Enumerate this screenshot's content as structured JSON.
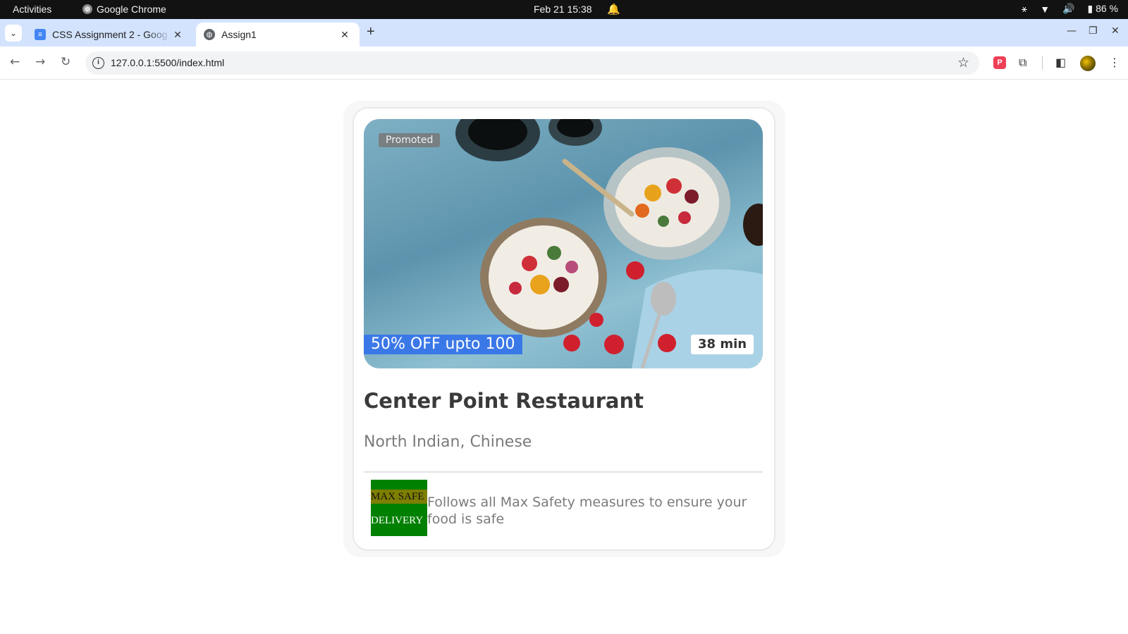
{
  "system_bar": {
    "activities": "Activities",
    "app_name": "Google Chrome",
    "datetime": "Feb 21  15:38",
    "battery": "86 %"
  },
  "browser": {
    "tabs": [
      {
        "title": "CSS Assignment 2 - Goog",
        "icon": "google-docs-icon",
        "active": false
      },
      {
        "title": "Assign1",
        "icon": "globe-icon",
        "active": true
      }
    ],
    "url": "127.0.0.1:5500/index.html"
  },
  "card": {
    "promoted_label": "Promoted",
    "offer": "50% OFF upto 100",
    "eta": "38 min",
    "restaurant_name": "Center Point Restaurant",
    "cuisine": "North Indian, Chinese",
    "safety_badge": {
      "line1": "MAX SAFE",
      "line2": "DELIVERY"
    },
    "safety_text": "Follows all Max Safety measures to ensure your food is safe"
  },
  "colors": {
    "offer_bg": "#3b78e7",
    "safety_badge_bg": "#008000",
    "safety_badge_highlight": "#7f7f00",
    "tabstrip_bg": "#d3e3fd"
  }
}
